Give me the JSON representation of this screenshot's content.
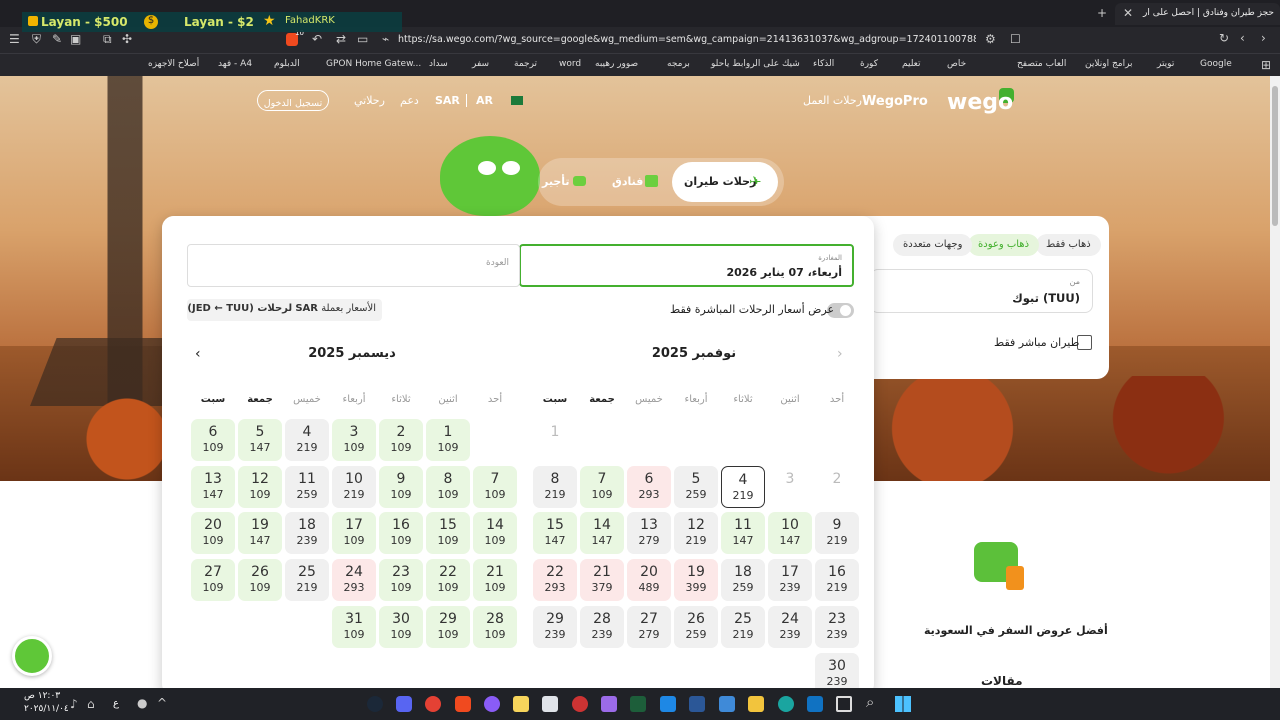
{
  "browser": {
    "tab_title": "حجز طيران وفنادق | احصل على أر",
    "url": "https://sa.wego.com/?wg_source=google&wg_medium=sem&wg_campaign=21413631037&wg_adgroup=172401100788&wg_content=7...",
    "overlay": {
      "balance1": "Layan - $500",
      "balance2": "Layan - $2",
      "user": "FahadKRK"
    },
    "shield_count": "10"
  },
  "bookmarks": [
    "Google",
    "تويتر",
    "برامج اونلاين",
    "العاب متصفح",
    "خاص",
    "تعليم",
    "كورة",
    "الذكاء",
    "شيك على الروابط ياحلو",
    "برمجه",
    "صوور رهيبه",
    "word",
    "ترجمة",
    "سفر",
    "سداد",
    "GPON Home Gatew...",
    "الدبلوم",
    "فهد - A4",
    "أصلاح الاجهزه"
  ],
  "header": {
    "logo": "wego",
    "wegopro": "WegoPro",
    "business": "رحلات العمل",
    "currency": "SAR",
    "lang": "AR",
    "my_trips": "رحلاتي",
    "support": "دعم",
    "login": "تسجيل الدخول"
  },
  "tabs": {
    "flights": "رحلات طيران",
    "hotels": "فنادق",
    "third": "تأجير"
  },
  "search": {
    "trip_types": [
      "ذهاب فقط",
      "ذهاب وعودة",
      "وجهات متعددة"
    ],
    "from_label": "من",
    "from_value": "تبوك (TUU)",
    "direct_only": "طيران مباشر فقط",
    "depart_label": "المغادرة",
    "depart_value": "أربعاء، 07 يناير 2026",
    "return_placeholder": "العودة",
    "direct_prices_toggle": "عرض أسعار الرحلات المباشرة فقط",
    "price_note_prefix": "الأسعار بعملة",
    "price_note_currency": "SAR",
    "price_note_suffix": "لرحلات (JED ← TUU)"
  },
  "calendar": {
    "weekdays": [
      "أحد",
      "اثنين",
      "ثلاثاء",
      "أربعاء",
      "خميس",
      "جمعة",
      "سبت"
    ],
    "months": [
      {
        "title": "نوفمبر 2025",
        "start": 6,
        "days": [
          {
            "d": "1",
            "p": "",
            "c": "disabled"
          },
          {
            "d": "2",
            "p": "",
            "c": "disabled"
          },
          {
            "d": "3",
            "p": "",
            "c": "disabled"
          },
          {
            "d": "4",
            "p": "219",
            "c": "sel"
          },
          {
            "d": "5",
            "p": "259",
            "c": "gr"
          },
          {
            "d": "6",
            "p": "293",
            "c": "r"
          },
          {
            "d": "7",
            "p": "109",
            "c": "g"
          },
          {
            "d": "8",
            "p": "219",
            "c": "gr"
          },
          {
            "d": "9",
            "p": "219",
            "c": "gr"
          },
          {
            "d": "10",
            "p": "147",
            "c": "g"
          },
          {
            "d": "11",
            "p": "147",
            "c": "g"
          },
          {
            "d": "12",
            "p": "219",
            "c": "gr"
          },
          {
            "d": "13",
            "p": "279",
            "c": "gr"
          },
          {
            "d": "14",
            "p": "147",
            "c": "g"
          },
          {
            "d": "15",
            "p": "147",
            "c": "g"
          },
          {
            "d": "16",
            "p": "219",
            "c": "gr"
          },
          {
            "d": "17",
            "p": "239",
            "c": "gr"
          },
          {
            "d": "18",
            "p": "259",
            "c": "gr"
          },
          {
            "d": "19",
            "p": "399",
            "c": "r"
          },
          {
            "d": "20",
            "p": "489",
            "c": "r"
          },
          {
            "d": "21",
            "p": "379",
            "c": "r"
          },
          {
            "d": "22",
            "p": "293",
            "c": "r"
          },
          {
            "d": "23",
            "p": "239",
            "c": "gr"
          },
          {
            "d": "24",
            "p": "239",
            "c": "gr"
          },
          {
            "d": "25",
            "p": "219",
            "c": "gr"
          },
          {
            "d": "26",
            "p": "259",
            "c": "gr"
          },
          {
            "d": "27",
            "p": "279",
            "c": "gr"
          },
          {
            "d": "28",
            "p": "239",
            "c": "gr"
          },
          {
            "d": "29",
            "p": "239",
            "c": "gr"
          },
          {
            "d": "30",
            "p": "239",
            "c": "gr"
          }
        ]
      },
      {
        "title": "ديسمبر 2025",
        "start": 1,
        "days": [
          {
            "d": "1",
            "p": "109",
            "c": "g"
          },
          {
            "d": "2",
            "p": "109",
            "c": "g"
          },
          {
            "d": "3",
            "p": "109",
            "c": "g"
          },
          {
            "d": "4",
            "p": "219",
            "c": "gr"
          },
          {
            "d": "5",
            "p": "147",
            "c": "g"
          },
          {
            "d": "6",
            "p": "109",
            "c": "g"
          },
          {
            "d": "7",
            "p": "109",
            "c": "g"
          },
          {
            "d": "8",
            "p": "109",
            "c": "g"
          },
          {
            "d": "9",
            "p": "109",
            "c": "g"
          },
          {
            "d": "10",
            "p": "219",
            "c": "gr"
          },
          {
            "d": "11",
            "p": "259",
            "c": "gr"
          },
          {
            "d": "12",
            "p": "109",
            "c": "g"
          },
          {
            "d": "13",
            "p": "147",
            "c": "g"
          },
          {
            "d": "14",
            "p": "109",
            "c": "g"
          },
          {
            "d": "15",
            "p": "109",
            "c": "g"
          },
          {
            "d": "16",
            "p": "109",
            "c": "g"
          },
          {
            "d": "17",
            "p": "109",
            "c": "g"
          },
          {
            "d": "18",
            "p": "239",
            "c": "gr"
          },
          {
            "d": "19",
            "p": "147",
            "c": "g"
          },
          {
            "d": "20",
            "p": "109",
            "c": "g"
          },
          {
            "d": "21",
            "p": "109",
            "c": "g"
          },
          {
            "d": "22",
            "p": "109",
            "c": "g"
          },
          {
            "d": "23",
            "p": "109",
            "c": "g"
          },
          {
            "d": "24",
            "p": "293",
            "c": "r"
          },
          {
            "d": "25",
            "p": "219",
            "c": "gr"
          },
          {
            "d": "26",
            "p": "109",
            "c": "g"
          },
          {
            "d": "27",
            "p": "109",
            "c": "g"
          },
          {
            "d": "28",
            "p": "109",
            "c": "g"
          },
          {
            "d": "29",
            "p": "109",
            "c": "g"
          },
          {
            "d": "30",
            "p": "109",
            "c": "g"
          },
          {
            "d": "31",
            "p": "109",
            "c": "g"
          }
        ]
      }
    ]
  },
  "promo": {
    "title": "أفضل عروض السفر في السعودية",
    "articles": "مقالات"
  },
  "taskbar": {
    "time": "١٢:٠٣ ص",
    "date": "٢٠٢٥/١١/٠٤",
    "lang": "ع"
  },
  "colors": {
    "green": "#4caf2a",
    "accent": "#44b02f"
  }
}
